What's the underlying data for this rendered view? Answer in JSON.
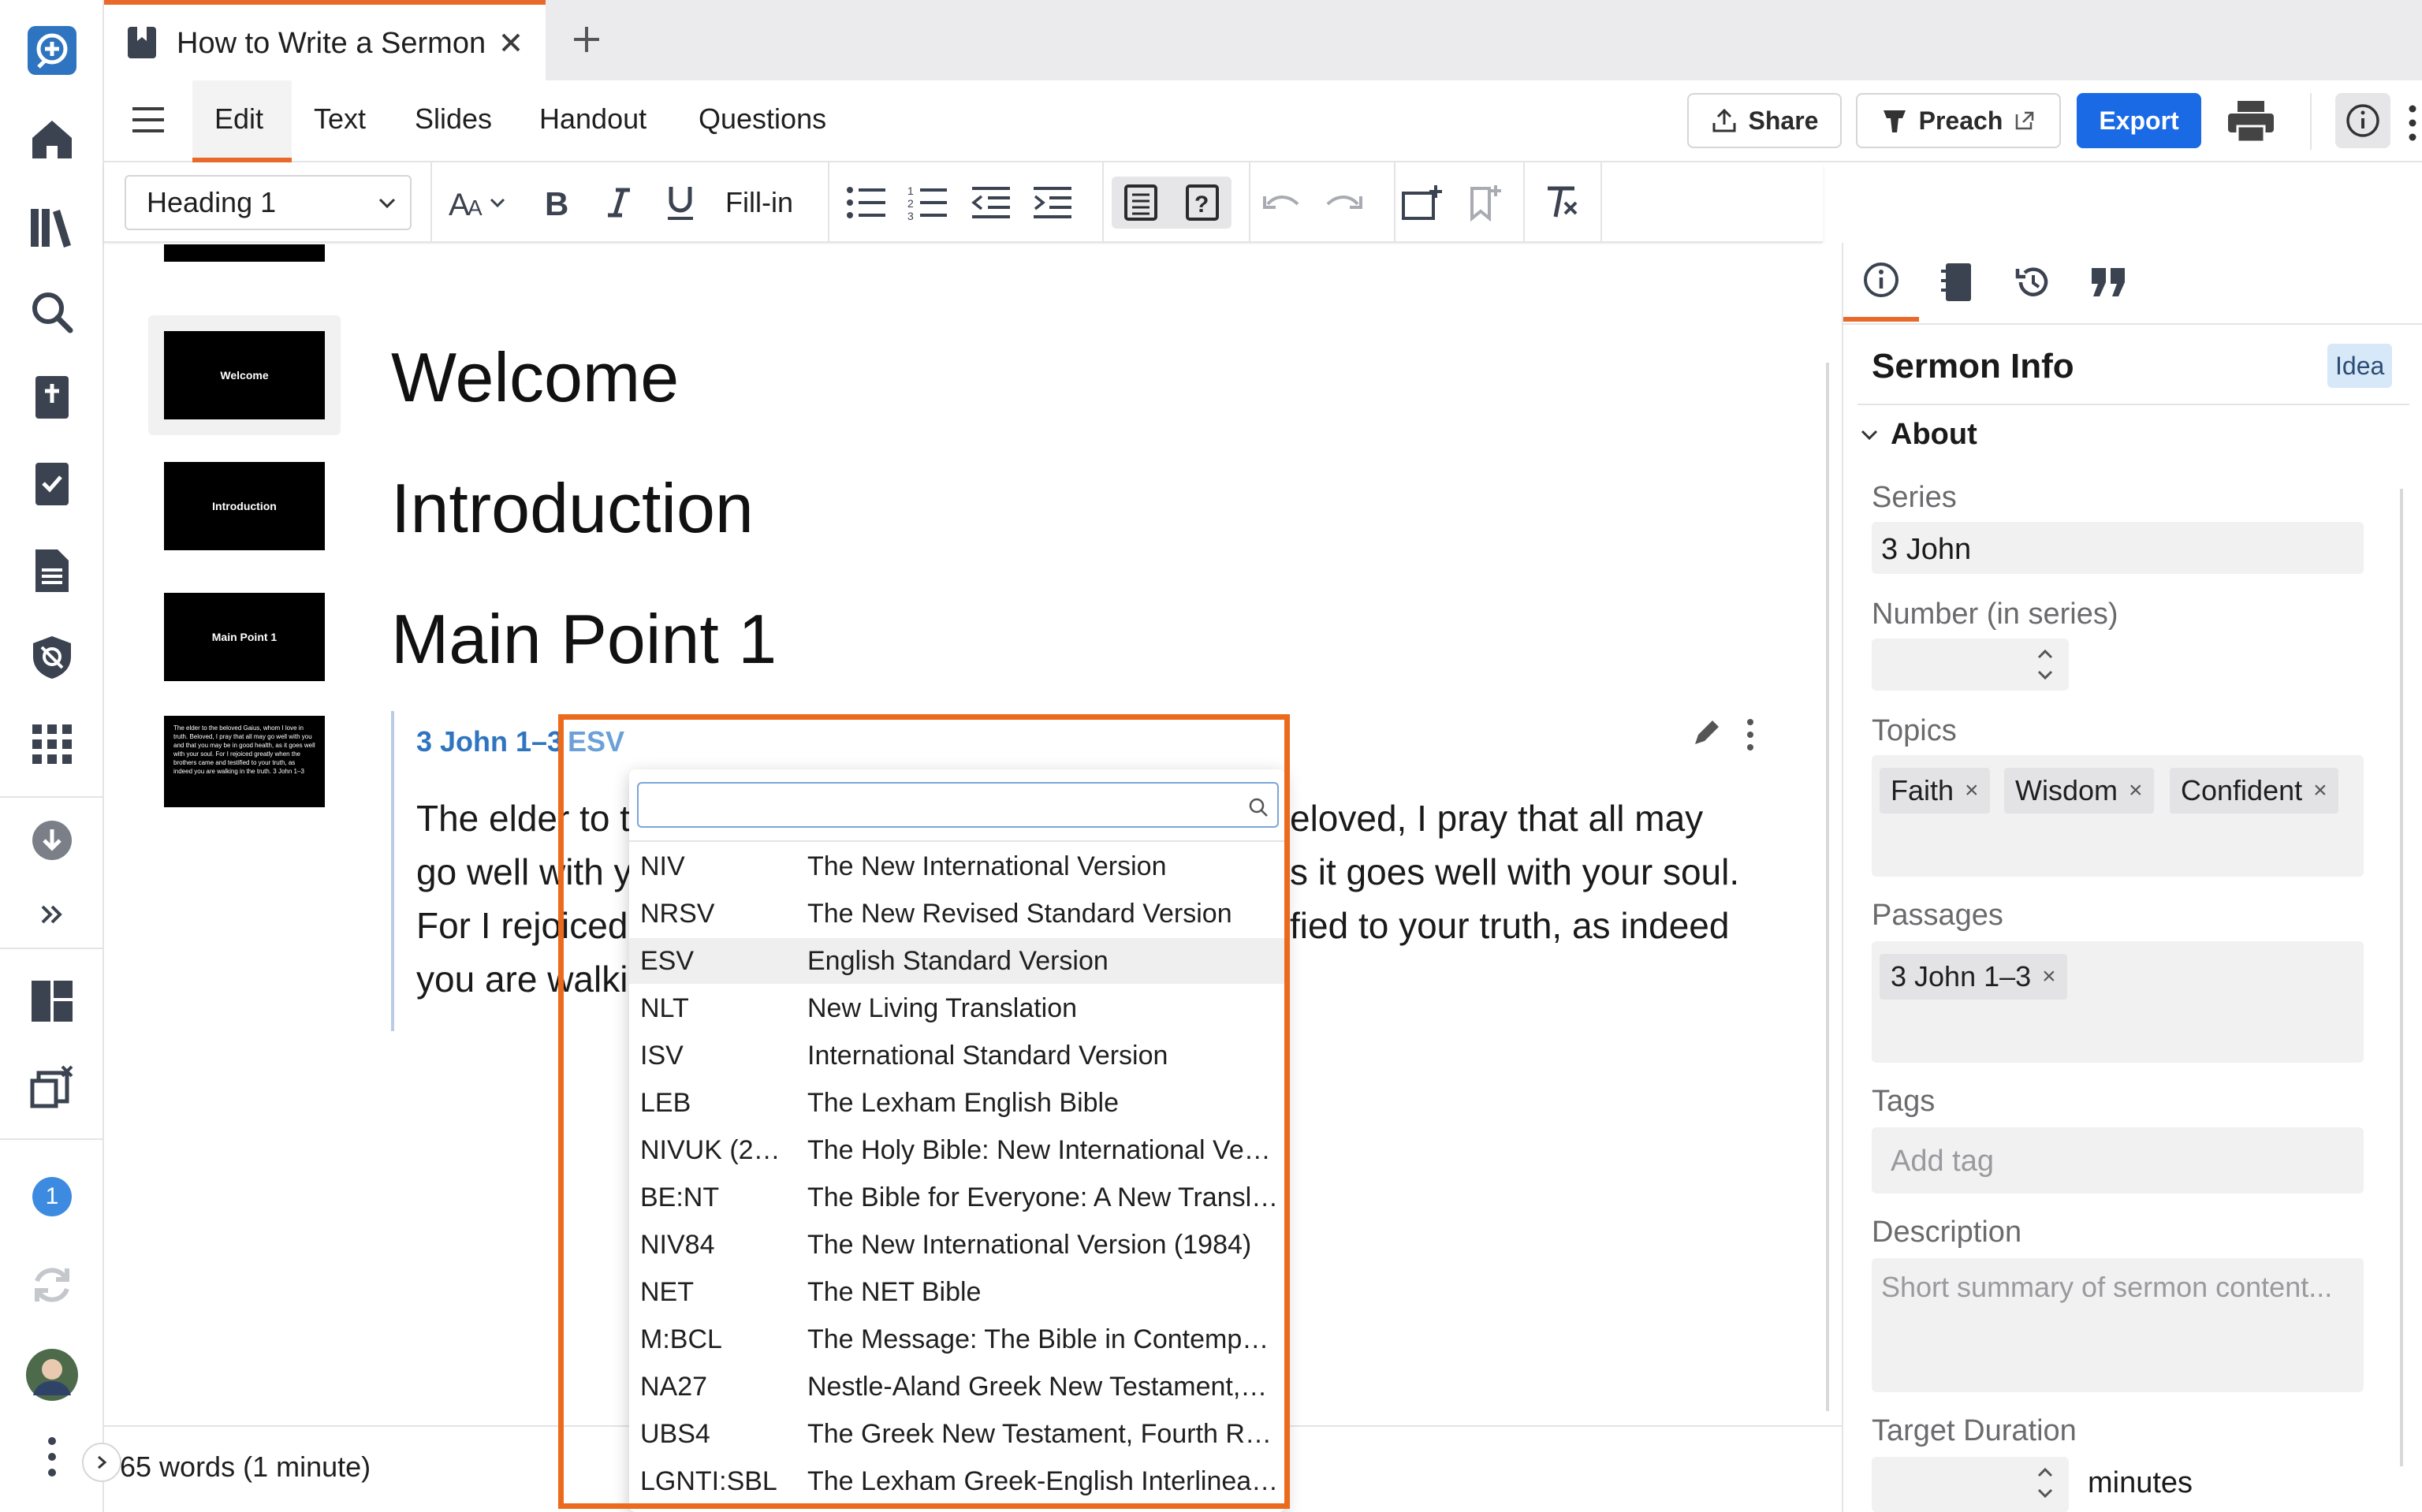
{
  "tab": {
    "title": "How to Write a Sermon"
  },
  "menu": {
    "items": [
      "Edit",
      "Text",
      "Slides",
      "Handout",
      "Questions"
    ]
  },
  "actions": {
    "share": "Share",
    "preach": "Preach",
    "export": "Export"
  },
  "format": {
    "style": "Heading 1",
    "fill_in": "Fill-in"
  },
  "slides": [
    {
      "thumb": "Welcome",
      "heading": "Welcome"
    },
    {
      "thumb": "Introduction",
      "heading": "Introduction"
    },
    {
      "thumb": "Main Point 1",
      "heading": "Main Point 1"
    }
  ],
  "passage_thumb": "The elder to the beloved Gaius, whom I love in truth. Beloved, I pray that all may go well with you and that you may be in good health, as it goes well with your soul. For I rejoiced greatly when the brothers came and testified to your truth, as indeed you are walking in the truth. 3 John 1–3",
  "passage": {
    "reference": "3 John 1–3",
    "version": "ESV",
    "lines": [
      "The elder to t",
      "go well with y",
      "For I rejoiced",
      "you are walki"
    ],
    "lines_right": [
      "eloved, I pray that all may",
      "s it goes well with your soul.",
      "fied to your truth, as indeed"
    ]
  },
  "versions": [
    {
      "abbr": "NIV",
      "name": "The New International Version"
    },
    {
      "abbr": "NRSV",
      "name": "The New Revised Standard Version"
    },
    {
      "abbr": "ESV",
      "name": "English Standard Version",
      "selected": true
    },
    {
      "abbr": "NLT",
      "name": "New Living Translation"
    },
    {
      "abbr": "ISV",
      "name": "International Standard Version"
    },
    {
      "abbr": "LEB",
      "name": "The Lexham English Bible"
    },
    {
      "abbr": "NIVUK (20…",
      "name": "The Holy Bible: New International Ve…"
    },
    {
      "abbr": "BE:NT",
      "name": "The Bible for Everyone: A New Transl…"
    },
    {
      "abbr": "NIV84",
      "name": "The New International Version (1984)"
    },
    {
      "abbr": "NET",
      "name": "The NET Bible"
    },
    {
      "abbr": "M:BCL",
      "name": "The Message: The Bible in Contempo…"
    },
    {
      "abbr": "NA27",
      "name": "Nestle-Aland Greek New Testament,…"
    },
    {
      "abbr": "UBS4",
      "name": "The Greek New Testament, Fourth Re…"
    },
    {
      "abbr": "LGNTI:SBL",
      "name": "The Lexham Greek-English Interlinea…"
    }
  ],
  "footer": {
    "word_count": "65 words (1 minute)"
  },
  "rail": {
    "badge": "1"
  },
  "panel": {
    "title": "Sermon Info",
    "badge": "Idea",
    "section": "About",
    "series_label": "Series",
    "series_value": "3 John",
    "number_label": "Number (in series)",
    "topics_label": "Topics",
    "topics": [
      "Faith",
      "Wisdom",
      "Confident"
    ],
    "passages_label": "Passages",
    "passages": [
      "3 John 1–3"
    ],
    "tags_label": "Tags",
    "tags_placeholder": "Add tag",
    "description_label": "Description",
    "description_placeholder": "Short summary of sermon content...",
    "duration_label": "Target Duration",
    "duration_unit": "minutes"
  },
  "colors": {
    "accent": "#e8692a",
    "primary": "#1f6feb",
    "link": "#2f74c0",
    "highlight": "#ec6a1c"
  }
}
